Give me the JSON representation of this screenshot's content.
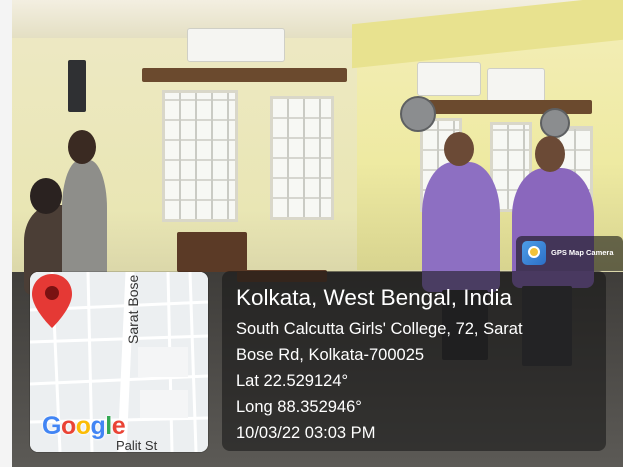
{
  "gps_badge": {
    "label": "GPS Map Camera",
    "icon": "gps-camera-icon"
  },
  "location": {
    "title": "Kolkata, West Bengal, India",
    "address_line1": "South Calcutta Girls' College, 72, Sarat",
    "address_line2": "Bose Rd, Kolkata-700025",
    "lat": "Lat 22.529124°",
    "long": "Long 88.352946°",
    "timestamp": "10/03/22 03:03 PM"
  },
  "map": {
    "street_vertical": "Sarat Bose",
    "street_bottom": "Palit St",
    "logo_letters": [
      {
        "ch": "G",
        "color": "#4285F4"
      },
      {
        "ch": "o",
        "color": "#EA4335"
      },
      {
        "ch": "o",
        "color": "#FBBC05"
      },
      {
        "ch": "g",
        "color": "#4285F4"
      },
      {
        "ch": "l",
        "color": "#34A853"
      },
      {
        "ch": "e",
        "color": "#EA4335"
      }
    ],
    "pin_color": "#E53935"
  }
}
